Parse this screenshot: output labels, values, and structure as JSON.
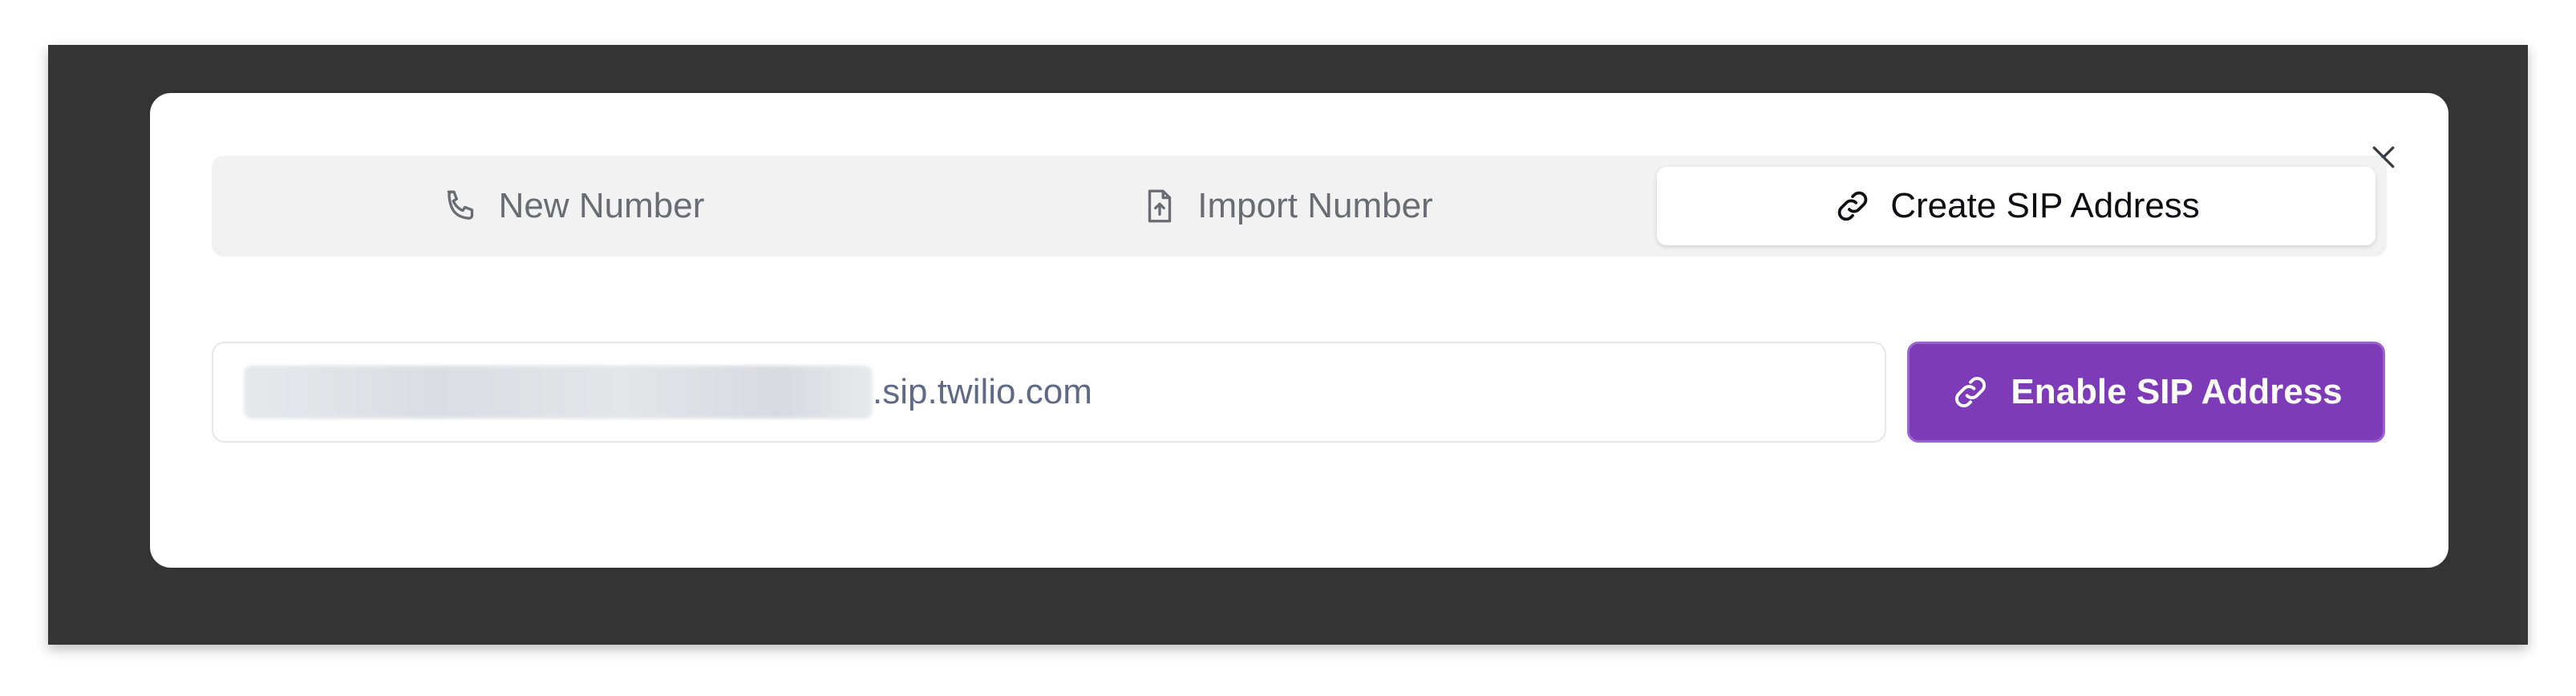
{
  "modal": {
    "tabs": [
      {
        "label": "New Number",
        "icon": "phone-icon"
      },
      {
        "label": "Import Number",
        "icon": "file-upload-icon"
      },
      {
        "label": "Create SIP Address",
        "icon": "link-icon",
        "active": true
      }
    ],
    "close_icon": "close-icon",
    "sip_input": {
      "suffix": ".sip.twilio.com"
    },
    "enable_button": {
      "label": "Enable SIP Address",
      "icon": "link-icon"
    }
  },
  "colors": {
    "backdrop": "#343434",
    "accent": "#7e3bb8",
    "tab_bar": "#f2f2f3",
    "active_text": "#0d0d12",
    "inactive_text": "#6b6b73"
  }
}
